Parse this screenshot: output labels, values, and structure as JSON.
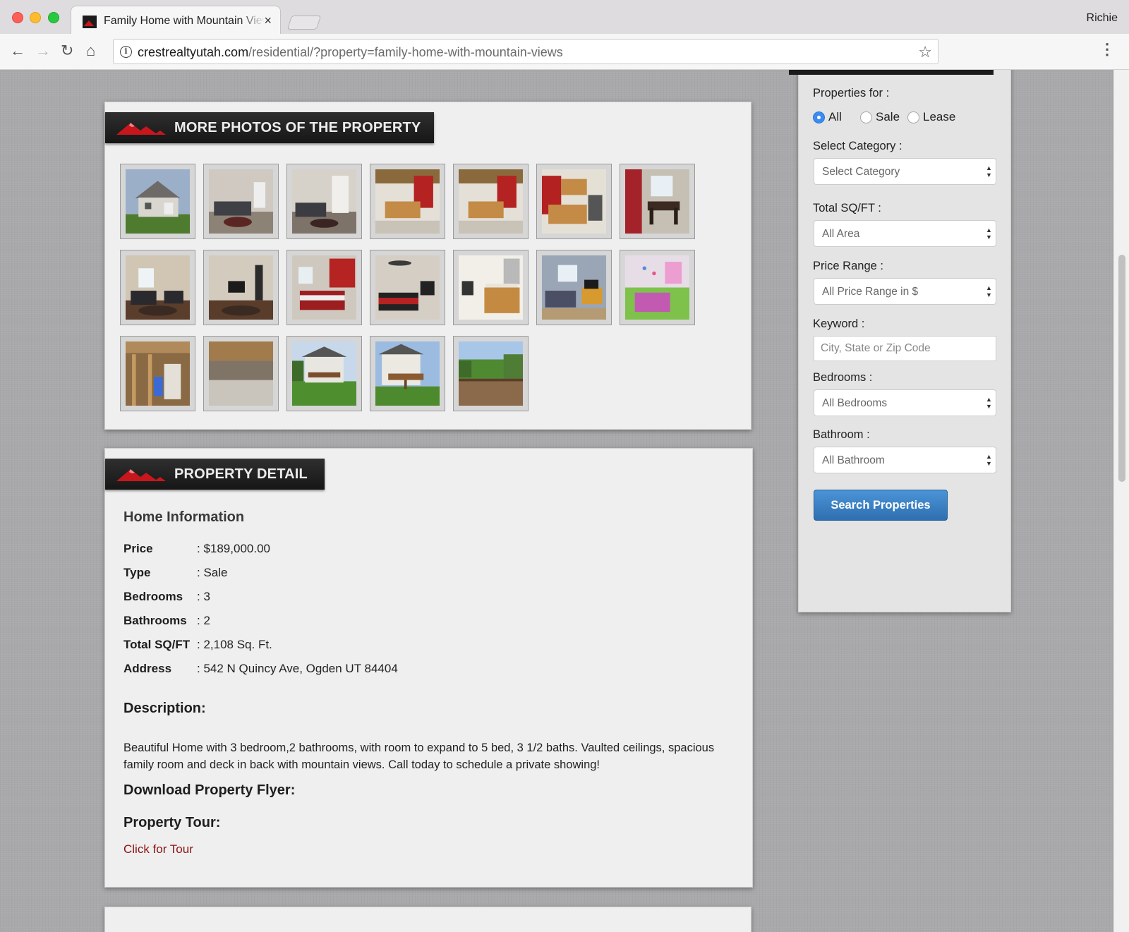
{
  "browser": {
    "tab_title": "Family Home with Mountain Views",
    "tab_close": "×",
    "profile_name": "Richie",
    "url_host": "crestrealtyutah.com",
    "url_path": "/residential/?property=family-home-with-mountain-views",
    "icons": {
      "back": "←",
      "forward": "→",
      "reload": "↻",
      "home": "⌂",
      "info": "i",
      "star": "☆",
      "menu": "⋮"
    }
  },
  "photos_section": {
    "title": "MORE PHOTOS OF THE PROPERTY",
    "thumbnails": [
      {
        "subject": "house-exterior-front"
      },
      {
        "subject": "living-room"
      },
      {
        "subject": "living-room-stairs"
      },
      {
        "subject": "kitchen-island"
      },
      {
        "subject": "kitchen-island"
      },
      {
        "subject": "kitchen-counter"
      },
      {
        "subject": "dining-room"
      },
      {
        "subject": "family-room"
      },
      {
        "subject": "family-room-tv"
      },
      {
        "subject": "bedroom-red"
      },
      {
        "subject": "bedroom-red-fan"
      },
      {
        "subject": "bathroom"
      },
      {
        "subject": "bedroom-blue"
      },
      {
        "subject": "kids-bedroom"
      },
      {
        "subject": "unfinished-basement-utility"
      },
      {
        "subject": "unfinished-basement"
      },
      {
        "subject": "house-exterior-back"
      },
      {
        "subject": "house-exterior-deck"
      },
      {
        "subject": "deck-view"
      }
    ]
  },
  "detail_section": {
    "title": "PROPERTY DETAIL",
    "home_info_heading": "Home Information",
    "rows": [
      {
        "label": "Price",
        "value": ": $189,000.00"
      },
      {
        "label": "Type",
        "value": ": Sale"
      },
      {
        "label": "Bedrooms",
        "value": ": 3"
      },
      {
        "label": "Bathrooms",
        "value": ": 2"
      },
      {
        "label": "Total SQ/FT",
        "value": ": 2,108 Sq. Ft."
      },
      {
        "label": "Address",
        "value": ": 542 N Quincy Ave, Ogden UT 84404"
      }
    ],
    "description_heading": "Description:",
    "description": "Beautiful Home with 3 bedroom,2 bathrooms, with room to expand to 5 bed, 3 1/2 baths. Vaulted ceilings, spacious family room and deck in back with mountain views. Call today to schedule a private showing!",
    "flyer_heading": "Download Property Flyer:",
    "tour_heading": "Property Tour:",
    "tour_link": "Click for Tour"
  },
  "search_sidebar": {
    "properties_for_label": "Properties for :",
    "radio_options": [
      {
        "label": "All",
        "checked": true
      },
      {
        "label": "Sale",
        "checked": false
      },
      {
        "label": "Lease",
        "checked": false
      }
    ],
    "category_label": "Select Category :",
    "category_value": "Select Category",
    "sqft_label": "Total SQ/FT :",
    "sqft_value": "All Area",
    "price_label": "Price Range :",
    "price_value": "All Price Range in $",
    "keyword_label": "Keyword :",
    "keyword_placeholder": "City, State or Zip Code",
    "bedrooms_label": "Bedrooms :",
    "bedrooms_value": "All Bedrooms",
    "bathroom_label": "Bathroom :",
    "bathroom_value": "All Bathroom",
    "search_button": "Search Properties",
    "select_arrows": "▲▼"
  },
  "colors": {
    "accent_red": "#c8161d",
    "button_blue": "#3a82c4",
    "link_red": "#8b1010",
    "header_black": "#1b1b1b"
  }
}
